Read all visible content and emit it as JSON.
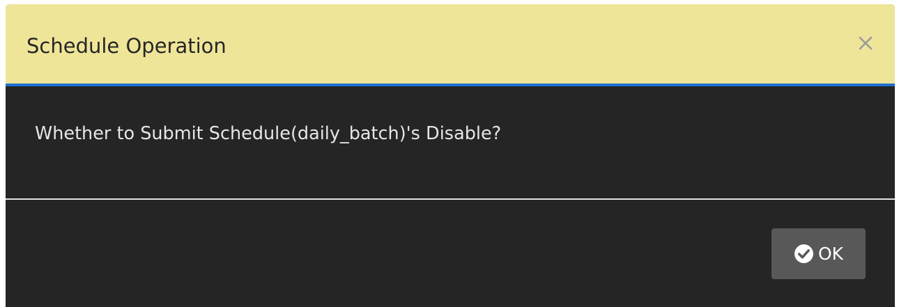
{
  "dialog": {
    "title": "Schedule Operation",
    "close_icon": "close-x-icon",
    "message": "Whether to Submit Schedule(daily_batch)'s Disable?",
    "ok_button": {
      "label": "OK",
      "icon": "check-circle-icon"
    }
  },
  "colors": {
    "header_bg": "#efe599",
    "header_border": "#1f6fd0",
    "body_bg": "#252525",
    "button_bg": "#585858"
  }
}
